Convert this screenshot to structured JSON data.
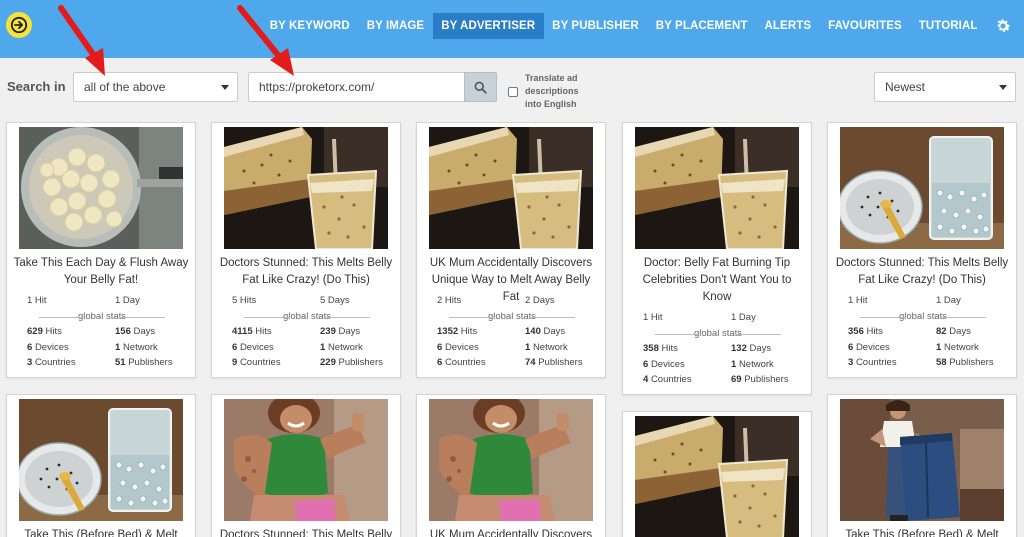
{
  "nav": {
    "items": [
      {
        "label": "BY KEYWORD",
        "active": false
      },
      {
        "label": "BY IMAGE",
        "active": false
      },
      {
        "label": "BY ADVERTISER",
        "active": true
      },
      {
        "label": "BY PUBLISHER",
        "active": false
      },
      {
        "label": "BY PLACEMENT",
        "active": false
      },
      {
        "label": "ALERTS",
        "active": false
      },
      {
        "label": "FAVOURITES",
        "active": false
      },
      {
        "label": "TUTORIAL",
        "active": false
      }
    ],
    "logo_icon": "arrow-right-circle-icon",
    "settings_icon": "gear-icon"
  },
  "search": {
    "label": "Search in",
    "scope_value": "all of the above",
    "query_value": "https://proketorx.com/",
    "translate_label": "Translate ad descriptions into English",
    "translate_checked": false,
    "sort_value": "Newest"
  },
  "colors": {
    "nav_bg": "#4fa8ec",
    "nav_active": "#2a7ec7",
    "logo_yellow": "#f5e23a",
    "arrow_red": "#e31b1b"
  },
  "cards": [
    {
      "title": "Take This Each Day & Flush Away Your Belly Fat!",
      "image": "bananas-in-pot",
      "hits": "1 Hit",
      "days": "1 Day",
      "global_label": "global stats",
      "g_hits": "629",
      "g_hits_label": "Hits",
      "g_days": "156",
      "g_days_label": "Days",
      "devices": "6",
      "devices_label": "Devices",
      "network": "1",
      "network_label": "Network",
      "countries": "3",
      "countries_label": "Countries",
      "publishers": "51",
      "publishers_label": "Publishers"
    },
    {
      "title": "Doctors Stunned: This Melts Belly Fat Like Crazy! (Do This)",
      "image": "pouring-drink",
      "hits": "5 Hits",
      "days": "5 Days",
      "global_label": "global stats",
      "g_hits": "4115",
      "g_hits_label": "Hits",
      "g_days": "239",
      "g_days_label": "Days",
      "devices": "6",
      "devices_label": "Devices",
      "network": "1",
      "network_label": "Network",
      "countries": "9",
      "countries_label": "Countries",
      "publishers": "229",
      "publishers_label": "Publishers"
    },
    {
      "title": "UK Mum Accidentally Discovers Unique Way to Melt Away Belly Fat",
      "image": "pouring-drink",
      "hits": "2 Hits",
      "days": "2 Days",
      "global_label": "global stats",
      "g_hits": "1352",
      "g_hits_label": "Hits",
      "g_days": "140",
      "g_days_label": "Days",
      "devices": "6",
      "devices_label": "Devices",
      "network": "1",
      "network_label": "Network",
      "countries": "6",
      "countries_label": "Countries",
      "publishers": "74",
      "publishers_label": "Publishers"
    },
    {
      "title": "Doctor: Belly Fat Burning Tip Celebrities Don't Want You to Know",
      "image": "pouring-drink",
      "hits": "1 Hit",
      "days": "1 Day",
      "global_label": "global stats",
      "g_hits": "358",
      "g_hits_label": "Hits",
      "g_days": "132",
      "g_days_label": "Days",
      "devices": "6",
      "devices_label": "Devices",
      "network": "1",
      "network_label": "Network",
      "countries": "4",
      "countries_label": "Countries",
      "publishers": "69",
      "publishers_label": "Publishers"
    },
    {
      "title": "Doctors Stunned: This Melts Belly Fat Like Crazy! (Do This)",
      "image": "chia-glass",
      "hits": "1 Hit",
      "days": "1 Day",
      "global_label": "global stats",
      "g_hits": "356",
      "g_hits_label": "Hits",
      "g_days": "82",
      "g_days_label": "Days",
      "devices": "6",
      "devices_label": "Devices",
      "network": "1",
      "network_label": "Network",
      "countries": "3",
      "countries_label": "Countries",
      "publishers": "58",
      "publishers_label": "Publishers"
    },
    {
      "title": "Take This (Before Bed) & Melt Your",
      "image": "chia-glass"
    },
    {
      "title": "Doctors Stunned: This Melts Belly",
      "image": "fitness-woman"
    },
    {
      "title": "UK Mum Accidentally Discovers",
      "image": "fitness-woman"
    },
    {
      "title": "",
      "image": "pouring-drink"
    },
    {
      "title": "Take This (Before Bed) & Melt Your",
      "image": "woman-big-jeans"
    }
  ]
}
